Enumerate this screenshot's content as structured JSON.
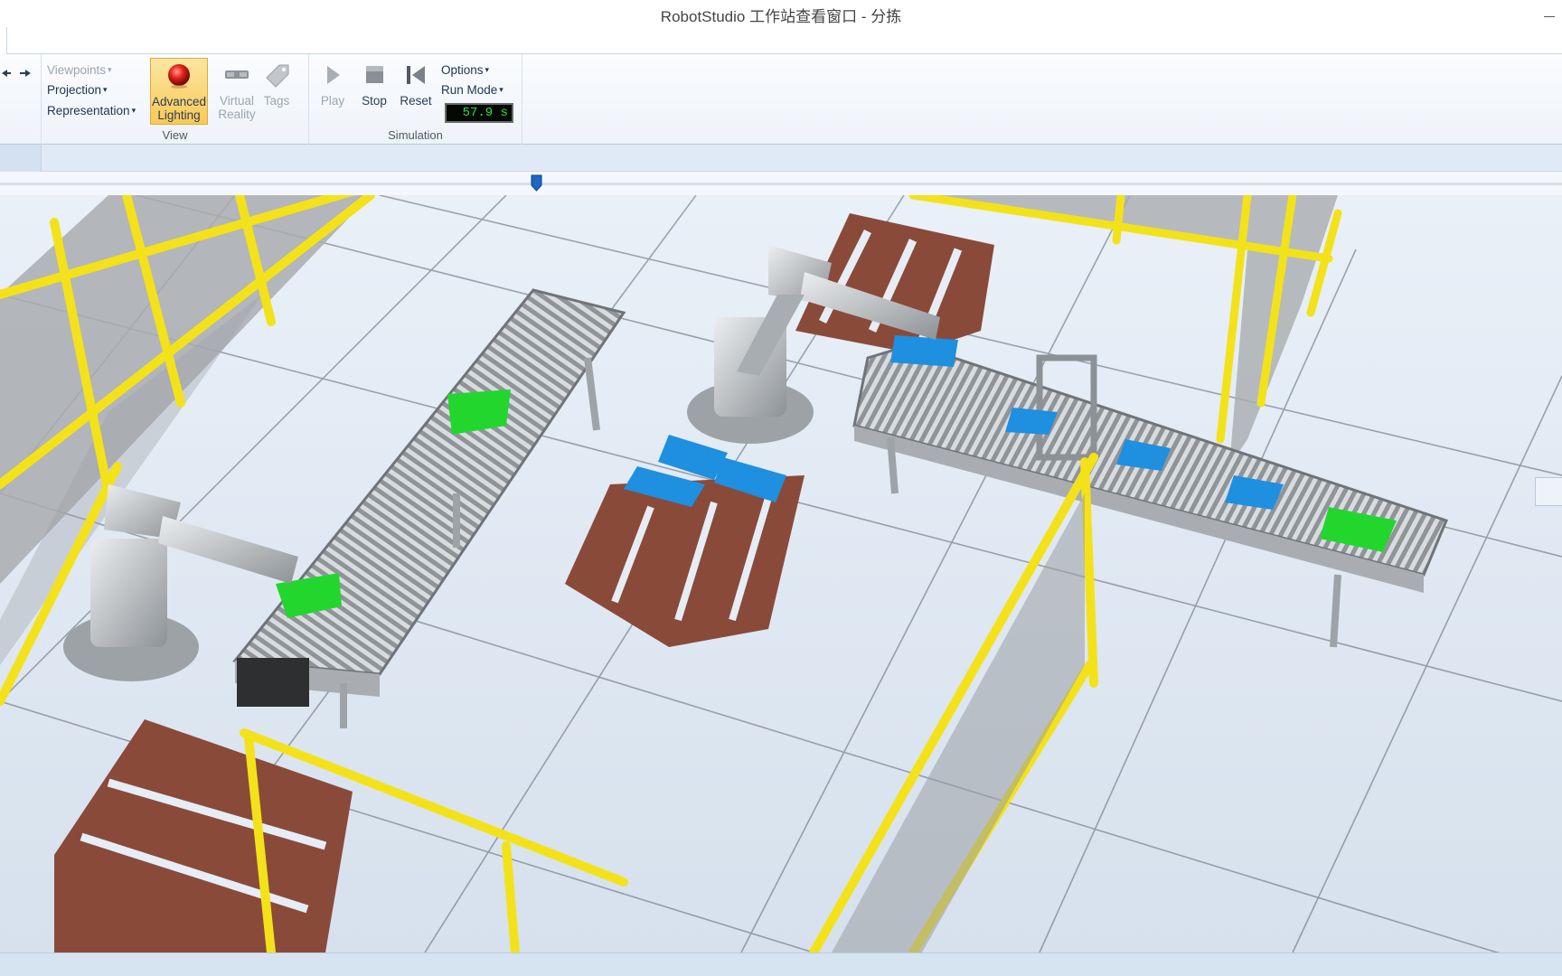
{
  "window": {
    "title": "RobotStudio 工作站查看窗口 - 分拣"
  },
  "ribbon": {
    "view_group": {
      "label": "View",
      "viewpoints": "Viewpoints",
      "projection": "Projection",
      "representation": "Representation",
      "advanced_lighting_line1": "Advanced",
      "advanced_lighting_line2": "Lighting",
      "virtual_reality_line1": "Virtual",
      "virtual_reality_line2": "Reality",
      "tags": "Tags"
    },
    "simulation_group": {
      "label": "Simulation",
      "play": "Play",
      "stop": "Stop",
      "reset": "Reset",
      "options": "Options",
      "run_mode": "Run Mode",
      "timer": "57.9 s"
    }
  },
  "timeline": {
    "position_fraction": 0.343
  },
  "colors": {
    "fence_yellow": "#f3e21a",
    "pallet_brown": "#8a4a3a",
    "box_green": "#22d62e",
    "box_blue": "#1f8fe0",
    "floor": "#dde7f2",
    "robot_grey": "#b8bcc0",
    "timer_green": "#2ee03a"
  },
  "icons": {
    "back": "arrow-left-icon",
    "forward": "arrow-right-icon",
    "lighting": "red-sphere-icon",
    "vr": "vr-headset-icon",
    "tags": "tag-icon",
    "play": "play-icon",
    "stop": "stop-icon",
    "reset": "reset-icon"
  }
}
